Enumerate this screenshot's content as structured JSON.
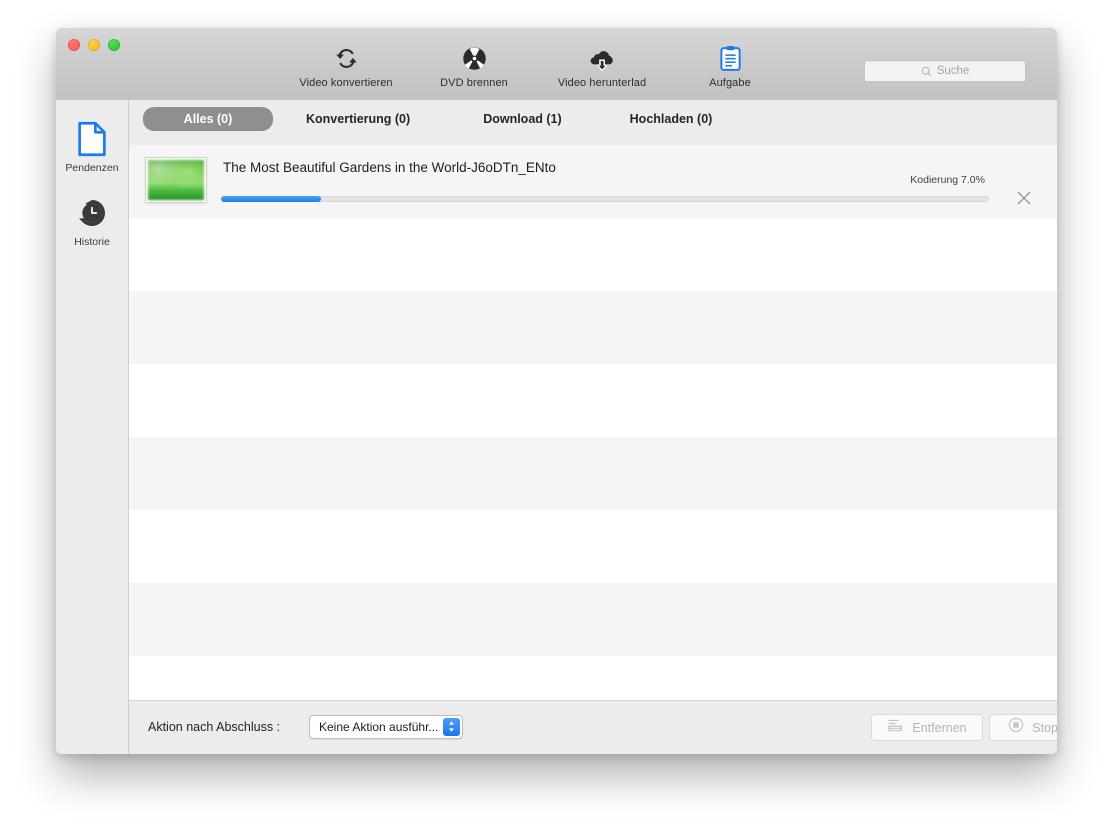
{
  "window": {
    "traffic_lights": [
      {
        "name": "close",
        "color": "#fc5f57"
      },
      {
        "name": "minimize",
        "color": "#fdbc2d"
      },
      {
        "name": "zoom",
        "color": "#2ac940"
      }
    ]
  },
  "toolbar": {
    "items": [
      {
        "label": "Video konvertieren",
        "icon": "refresh-circular-arrows-icon"
      },
      {
        "label": "DVD brennen",
        "icon": "disc-burn-icon"
      },
      {
        "label": "Video herunterlad",
        "icon": "cloud-download-icon"
      },
      {
        "label": "Aufgabe",
        "icon": "clipboard-list-icon"
      }
    ],
    "search": {
      "placeholder": "Suche",
      "icon": "search-icon",
      "value": ""
    }
  },
  "sidebar": {
    "items": [
      {
        "label": "Pendenzen",
        "icon": "document-page-icon",
        "active": true,
        "color": "#1c7ced"
      },
      {
        "label": "Historie",
        "icon": "history-clock-icon",
        "active": false,
        "color": "#3a3a3a"
      }
    ]
  },
  "tabs": [
    {
      "label": "Alles (0)",
      "active": true
    },
    {
      "label": "Konvertierung (0)",
      "active": false
    },
    {
      "label": "Download (1)",
      "active": false
    },
    {
      "label": "Hochladen (0)",
      "active": false
    }
  ],
  "task_list": {
    "rows": [
      {
        "title": "The Most Beautiful Gardens in the World-J6oDTn_ENto",
        "status": "Kodierung 7.0%",
        "progress_percent": 13,
        "thumbnail": "green-garden-thumbnail",
        "close_icon": "close-x-icon"
      }
    ],
    "empty_row_count": 7
  },
  "footer": {
    "action_label": "Aktion nach Abschluss :",
    "action_select": {
      "value": "Keine Aktion ausführ...",
      "stepper_icon": "chevron-up-down-icon",
      "accent": "#1a77e8"
    },
    "buttons": [
      {
        "label": "Entfernen",
        "icon": "remove-list-icon",
        "enabled": false
      },
      {
        "label": "Stoppen",
        "icon": "stop-circle-icon",
        "enabled": false
      }
    ]
  },
  "colors": {
    "progress_blue": "#2e87ef",
    "tab_active_bg": "#908f8f",
    "window_bg": "#ffffff",
    "chrome_gray": "#ececec"
  }
}
